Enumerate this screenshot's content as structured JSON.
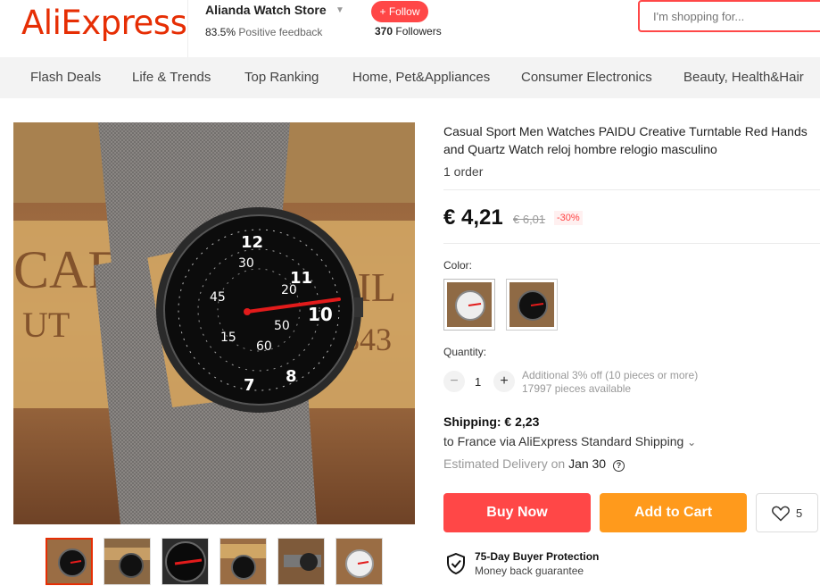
{
  "header": {
    "logo": "AliExpress",
    "store_name": "Alianda Watch Store",
    "feedback_percent": "83.5%",
    "feedback_label": "Positive feedback",
    "follow_label": "+ Follow",
    "followers_count": "370",
    "followers_label": "Followers",
    "search_placeholder": "I'm shopping for..."
  },
  "nav": {
    "items": [
      "Flash Deals",
      "Life & Trends",
      "Top Ranking",
      "Home, Pet&Appliances",
      "Consumer Electronics",
      "Beauty, Health&Hair"
    ]
  },
  "product": {
    "title": "Casual Sport Men Watches PAIDU Creative Turntable Red Hands and Quartz Watch reloj hombre relogio masculino",
    "orders": "1 order",
    "price": "€ 4,21",
    "old_price": "€ 6,01",
    "discount": "-30%",
    "color_label": "Color:",
    "quantity_label": "Quantity:",
    "quantity_value": "1",
    "qty_minus": "−",
    "qty_plus": "+",
    "quantity_note_1": "Additional 3% off (10 pieces or more)",
    "quantity_note_2": "17997 pieces available",
    "shipping_label": "Shipping: € 2,23",
    "shipping_dest": "to France via AliExpress Standard Shipping",
    "shipping_caret": "⌄",
    "delivery_label": "Estimated Delivery on",
    "delivery_date": "Jan 30",
    "buy_now": "Buy Now",
    "add_to_cart": "Add to Cart",
    "wishlist_count": "5",
    "protection_title": "75-Day Buyer Protection",
    "protection_sub": "Money back guarantee"
  },
  "colors": {
    "brand": "#e62e04",
    "buy": "#ff4747",
    "cart": "#ff9a1c"
  }
}
